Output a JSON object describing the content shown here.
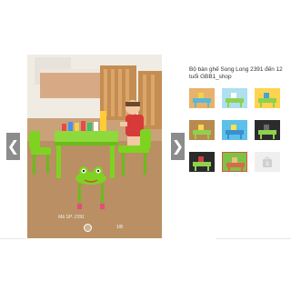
{
  "product": {
    "title": "Bộ bàn ghế Song Long 2391 đến 12 tuổi GBB1_shop"
  },
  "viewer": {
    "prev_icon": "chevron-left-icon",
    "next_icon": "chevron-right-icon",
    "prev_glyph": "❮",
    "next_glyph": "❯",
    "watermark": "Mã SP: 2391",
    "counter": "1/8"
  },
  "thumbnails": [
    {
      "name": "thumb-1",
      "colors": [
        "#e8b26a",
        "#57b8d9",
        "#f2d24a"
      ],
      "active": false
    },
    {
      "name": "thumb-2",
      "colors": [
        "#aee0f0",
        "#8fd14f",
        "#ffffff"
      ],
      "active": false
    },
    {
      "name": "thumb-3",
      "colors": [
        "#ffd34f",
        "#8fd14f",
        "#3ea6d8"
      ],
      "active": false
    },
    {
      "name": "thumb-4",
      "colors": [
        "#b78b4f",
        "#8fd14f",
        "#ffd34f"
      ],
      "active": false
    },
    {
      "name": "thumb-5",
      "colors": [
        "#5cc0e8",
        "#3a8fd0",
        "#ffe24a"
      ],
      "active": false
    },
    {
      "name": "thumb-6",
      "colors": [
        "#2c2c2c",
        "#8fd14f",
        "#6a6a6a"
      ],
      "active": false
    },
    {
      "name": "thumb-7",
      "colors": [
        "#2a2a2a",
        "#8fd14f",
        "#d04040"
      ],
      "active": false
    },
    {
      "name": "thumb-8",
      "colors": [
        "#7cc444",
        "#d96a4a",
        "#e8c080"
      ],
      "active": true
    },
    {
      "name": "thumb-9",
      "colors": [
        "#efefef",
        "#efefef",
        "#efefef"
      ],
      "active": false,
      "placeholder": true
    }
  ],
  "colors": {
    "accent": "#d9534f",
    "nav_bg": "#8c8c8c",
    "chair_green": "#7ed321"
  }
}
